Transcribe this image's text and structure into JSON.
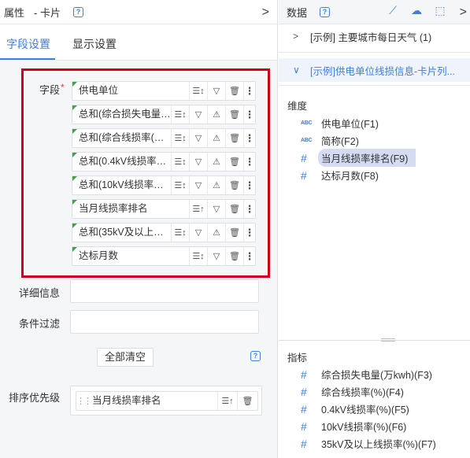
{
  "left": {
    "title": "属性",
    "subtitle": "- 卡片",
    "tabs": [
      "字段设置",
      "显示设置"
    ],
    "field_label": "字段",
    "required_mark": "*",
    "fields": [
      {
        "name": "供电单位",
        "sort": "sort-default",
        "warn": false
      },
      {
        "name": "总和(综合损失电量(…",
        "sort": "sort-default",
        "warn": true
      },
      {
        "name": "总和(综合线损率(…",
        "sort": "sort-default",
        "warn": true
      },
      {
        "name": "总和(0.4kV线损率…",
        "sort": "sort-default",
        "warn": true
      },
      {
        "name": "总和(10kV线损率…",
        "sort": "sort-default",
        "warn": true
      },
      {
        "name": "当月线损率排名",
        "sort": "sort-asc",
        "warn": false
      },
      {
        "name": "总和(35kV及以上…",
        "sort": "sort-default",
        "warn": true
      },
      {
        "name": "达标月数",
        "sort": "sort-default",
        "warn": false
      }
    ],
    "detail_label": "详细信息",
    "filter_label": "条件过滤",
    "clear_all": "全部清空",
    "sort_priority_label": "排序优先级",
    "sort_item": "当月线损率排名"
  },
  "right": {
    "title": "数据",
    "datasets": [
      {
        "label": "[示例] 主要城市每日天气 (1)",
        "expanded": false
      },
      {
        "label": "[示例]供电单位线损信息-卡片列...",
        "expanded": true
      }
    ],
    "dimension_title": "维度",
    "dimensions": [
      {
        "label": "供电单位(F1)",
        "type": "ABC"
      },
      {
        "label": "简称(F2)",
        "type": "ABC"
      },
      {
        "label": "当月线损率排名(F9)",
        "type": "#"
      },
      {
        "label": "达标月数(F8)",
        "type": "#"
      }
    ],
    "measure_title": "指标",
    "measures": [
      {
        "label": "综合损失电量(万kwh)(F3)",
        "type": "#"
      },
      {
        "label": "综合线损率(%)(F4)",
        "type": "#"
      },
      {
        "label": "0.4kV线损率(%)(F5)",
        "type": "#"
      },
      {
        "label": "10kV线损率(%)(F6)",
        "type": "#"
      },
      {
        "label": "35kV及以上线损率(%)(F7)",
        "type": "#"
      }
    ]
  },
  "colors": {
    "accent": "#3d7fe0",
    "highlight_box": "#d0021b",
    "field_marker": "#43a047"
  }
}
